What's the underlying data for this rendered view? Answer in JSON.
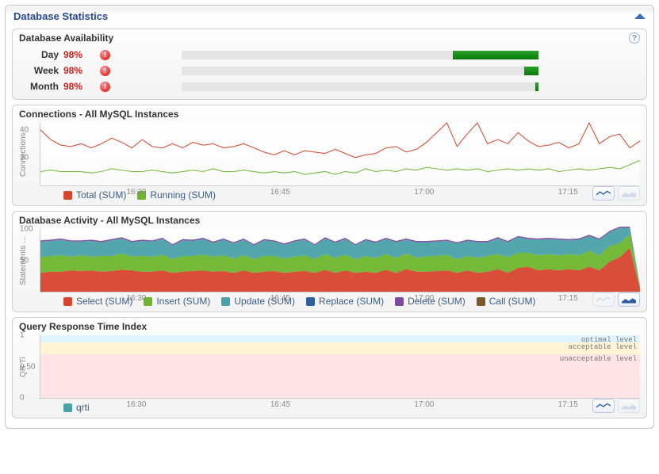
{
  "header": {
    "title": "Database Statistics"
  },
  "availability": {
    "title": "Database Availability",
    "rows": [
      {
        "label": "Day",
        "pct": "98%",
        "fill_start": 76,
        "fill_end": 100
      },
      {
        "label": "Week",
        "pct": "98%",
        "fill_start": 96,
        "fill_end": 100
      },
      {
        "label": "Month",
        "pct": "98%",
        "fill_start": 99,
        "fill_end": 100
      }
    ]
  },
  "connections": {
    "title": "Connections - All MySQL Instances",
    "ylabel": "Connections",
    "yticks": [
      "20",
      "40"
    ],
    "xticks": [
      "16:30",
      "16:45",
      "17:00",
      "17:15"
    ],
    "legend": [
      {
        "label": "Total (SUM)",
        "color": "#d6452d"
      },
      {
        "label": "Running (SUM)",
        "color": "#6eb52d"
      }
    ]
  },
  "activity": {
    "title": "Database Activity - All MySQL Instances",
    "ylabel": "Statements ...",
    "yticks": [
      "50",
      "100"
    ],
    "xticks": [
      "16:30",
      "16:45",
      "17:00",
      "17:15"
    ],
    "legend": [
      {
        "label": "Select (SUM)",
        "color": "#d6452d"
      },
      {
        "label": "Insert (SUM)",
        "color": "#6eb52d"
      },
      {
        "label": "Update (SUM)",
        "color": "#4aa2a8"
      },
      {
        "label": "Replace (SUM)",
        "color": "#2e5e9e"
      },
      {
        "label": "Delete (SUM)",
        "color": "#7a4a9e"
      },
      {
        "label": "Call (SUM)",
        "color": "#7a5a2a"
      }
    ]
  },
  "qrti": {
    "title": "Query Response Time Index",
    "ylabel": "QR Ti",
    "yticks": [
      "0",
      "0.50",
      "1"
    ],
    "xticks": [
      "16:30",
      "16:45",
      "17:00",
      "17:15"
    ],
    "bands": [
      {
        "label": "optimal level",
        "top": 0,
        "height": 12,
        "color": "#dff4ff"
      },
      {
        "label": "acceptable level",
        "top": 12,
        "height": 18,
        "color": "#fff4d6"
      },
      {
        "label": "unacceptable level",
        "top": 30,
        "height": 70,
        "color": "#ffe4e6"
      }
    ],
    "legend": [
      {
        "label": "qrti",
        "color": "#4aa2a8"
      }
    ]
  },
  "chart_data": [
    {
      "type": "line",
      "title": "Connections - All MySQL Instances",
      "xlabel": "",
      "ylabel": "Connections",
      "ylim": [
        0,
        45
      ],
      "x": [
        0,
        1,
        2,
        3,
        4,
        5,
        6,
        7,
        8,
        9,
        10,
        11,
        12,
        13,
        14,
        15,
        16,
        17,
        18,
        19,
        20,
        21,
        22,
        23,
        24,
        25,
        26,
        27,
        28,
        29,
        30,
        31,
        32,
        33,
        34,
        35,
        36,
        37,
        38,
        39,
        40,
        41,
        42,
        43,
        44,
        45,
        46,
        47,
        48,
        49,
        50,
        51,
        52,
        53,
        54,
        55,
        56,
        57,
        58,
        59
      ],
      "x_ticks": [
        10,
        25,
        40,
        55
      ],
      "x_tick_labels": [
        "16:30",
        "16:45",
        "17:00",
        "17:15"
      ],
      "series": [
        {
          "name": "Total (SUM)",
          "color": "#d6452d",
          "values": [
            40,
            33,
            29,
            28,
            30,
            27,
            30,
            34,
            31,
            27,
            33,
            28,
            27,
            30,
            27,
            31,
            29,
            30,
            27,
            28,
            30,
            27,
            24,
            22,
            25,
            22,
            25,
            24,
            23,
            26,
            23,
            20,
            22,
            23,
            27,
            28,
            24,
            26,
            31,
            38,
            45,
            28,
            37,
            45,
            30,
            33,
            30,
            38,
            32,
            28,
            29,
            31,
            27,
            30,
            45,
            30,
            35,
            37,
            27,
            32
          ]
        },
        {
          "name": "Running (SUM)",
          "color": "#6eb52d",
          "values": [
            10,
            11,
            10,
            10,
            10,
            9,
            10,
            12,
            11,
            10,
            10,
            11,
            10,
            9,
            10,
            11,
            10,
            12,
            10,
            10,
            11,
            10,
            9,
            10,
            9,
            10,
            8,
            9,
            10,
            8,
            10,
            9,
            12,
            10,
            11,
            10,
            12,
            11,
            13,
            12,
            11,
            12,
            11,
            12,
            10,
            11,
            12,
            11,
            12,
            11,
            12,
            10,
            11,
            12,
            11,
            12,
            13,
            12,
            15,
            18
          ]
        }
      ]
    },
    {
      "type": "area",
      "title": "Database Activity - All MySQL Instances",
      "xlabel": "",
      "ylabel": "Statements",
      "ylim": [
        0,
        100
      ],
      "x_ticks": [
        10,
        25,
        40,
        55
      ],
      "x_tick_labels": [
        "16:30",
        "16:45",
        "17:00",
        "17:15"
      ],
      "stack_order": [
        "Select (SUM)",
        "Insert (SUM)",
        "Update (SUM)",
        "Replace (SUM)",
        "Delete (SUM)",
        "Call (SUM)"
      ],
      "series": [
        {
          "name": "Select (SUM)",
          "color": "#d6452d",
          "values": [
            30,
            32,
            32,
            34,
            33,
            34,
            32,
            33,
            35,
            34,
            32,
            32,
            34,
            30,
            32,
            33,
            34,
            32,
            33,
            30,
            34,
            30,
            32,
            33,
            30,
            32,
            33,
            30,
            35,
            30,
            34,
            30,
            32,
            30,
            35,
            30,
            36,
            32,
            32,
            33,
            34,
            30,
            34,
            30,
            32,
            36,
            30,
            38,
            40,
            34,
            36,
            34,
            36,
            34,
            40,
            34,
            48,
            55,
            70,
            5
          ]
        },
        {
          "name": "Insert (SUM)",
          "color": "#6eb52d",
          "values": [
            25,
            25,
            26,
            22,
            25,
            22,
            25,
            24,
            26,
            22,
            25,
            24,
            25,
            22,
            25,
            24,
            25,
            24,
            25,
            23,
            24,
            22,
            25,
            24,
            23,
            24,
            25,
            22,
            25,
            24,
            25,
            22,
            25,
            24,
            25,
            24,
            25,
            22,
            25,
            24,
            25,
            22,
            23,
            24,
            25,
            24,
            25,
            24,
            22,
            24,
            24,
            24,
            24,
            24,
            25,
            24,
            25,
            22,
            22,
            3
          ]
        },
        {
          "name": "Update (SUM)",
          "color": "#4aa2a8",
          "values": [
            25,
            24,
            25,
            24,
            22,
            25,
            22,
            25,
            24,
            23,
            24,
            24,
            25,
            22,
            25,
            24,
            25,
            22,
            25,
            24,
            25,
            22,
            25,
            23,
            22,
            24,
            25,
            22,
            25,
            24,
            25,
            22,
            25,
            24,
            24,
            25,
            22,
            25,
            22,
            23,
            22,
            25,
            24,
            25,
            22,
            25,
            24,
            25,
            22,
            25,
            24,
            25,
            22,
            25,
            24,
            25,
            22,
            25,
            10,
            1
          ]
        },
        {
          "name": "Replace (SUM)",
          "color": "#2e5e9e",
          "values": [
            0,
            0,
            0,
            0,
            0,
            0,
            0,
            0,
            0,
            0,
            0,
            0,
            0,
            0,
            0,
            0,
            0,
            0,
            0,
            0,
            0,
            0,
            0,
            0,
            0,
            0,
            0,
            0,
            0,
            0,
            0,
            0,
            0,
            0,
            0,
            0,
            0,
            0,
            0,
            0,
            0,
            0,
            0,
            0,
            0,
            0,
            0,
            0,
            0,
            0,
            0,
            0,
            0,
            0,
            0,
            0,
            0,
            0,
            0,
            0
          ]
        },
        {
          "name": "Delete (SUM)",
          "color": "#7a4a9e",
          "values": [
            2,
            2,
            2,
            2,
            2,
            2,
            2,
            2,
            2,
            2,
            2,
            2,
            2,
            2,
            2,
            2,
            2,
            2,
            2,
            2,
            2,
            2,
            2,
            2,
            2,
            2,
            2,
            2,
            2,
            2,
            2,
            2,
            2,
            2,
            2,
            2,
            2,
            2,
            2,
            2,
            2,
            2,
            2,
            2,
            2,
            2,
            2,
            2,
            2,
            2,
            2,
            2,
            2,
            2,
            2,
            2,
            2,
            2,
            2,
            1
          ]
        },
        {
          "name": "Call (SUM)",
          "color": "#7a5a2a",
          "values": [
            0,
            0,
            0,
            0,
            0,
            0,
            0,
            0,
            0,
            0,
            0,
            0,
            0,
            0,
            0,
            0,
            0,
            0,
            0,
            0,
            0,
            0,
            0,
            0,
            0,
            0,
            0,
            0,
            0,
            0,
            0,
            0,
            0,
            0,
            0,
            0,
            0,
            0,
            0,
            0,
            0,
            0,
            0,
            0,
            0,
            0,
            0,
            0,
            0,
            0,
            0,
            0,
            0,
            0,
            0,
            0,
            0,
            0,
            0,
            0
          ]
        }
      ]
    },
    {
      "type": "line",
      "title": "Query Response Time Index",
      "xlabel": "",
      "ylabel": "QR Ti",
      "ylim": [
        0,
        1
      ],
      "x_ticks": [
        10,
        25,
        40,
        55
      ],
      "x_tick_labels": [
        "16:30",
        "16:45",
        "17:00",
        "17:15"
      ],
      "bands": [
        {
          "label": "optimal level",
          "from": 0.9,
          "to": 1.0
        },
        {
          "label": "acceptable level",
          "from": 0.7,
          "to": 0.9
        },
        {
          "label": "unacceptable level",
          "from": 0.0,
          "to": 0.7
        }
      ],
      "series": [
        {
          "name": "qrti",
          "color": "#4aa2a8",
          "values": []
        }
      ]
    }
  ]
}
